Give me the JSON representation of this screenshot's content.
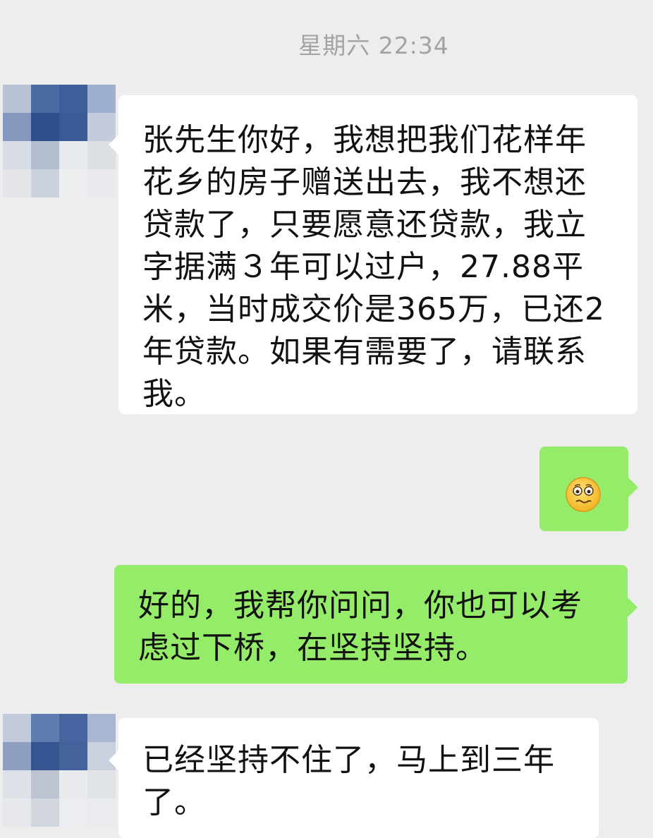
{
  "chat": {
    "timestamp": "星期六 22:34",
    "messages": [
      {
        "side": "left",
        "text": "张先生你好，我想把我们花样年花乡的房子赠送出去，我不想还贷款了，只要愿意还贷款，我立字据满３年可以过户，27.88平米，当时成交价是365万，已还2年贷款。如果有需要了，请联系我。"
      },
      {
        "side": "right",
        "emoji": "grimacing-smiley-emoji"
      },
      {
        "side": "right",
        "text": "好的，我帮你问问，你也可以考虑过下桥，在坚持坚持。"
      },
      {
        "side": "left",
        "text": "已经坚持不住了，马上到三年了。"
      }
    ]
  },
  "colors": {
    "background": "#ededed",
    "incoming_bubble": "#ffffff",
    "outgoing_bubble": "#95ec69",
    "timestamp_text": "#a3a3a3"
  }
}
